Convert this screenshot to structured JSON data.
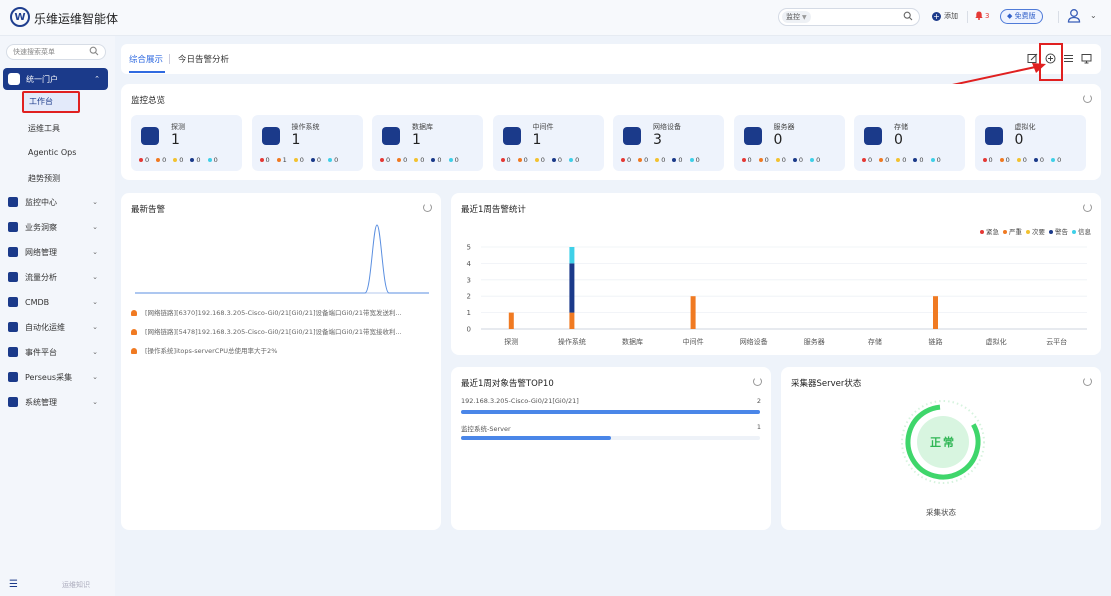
{
  "app": {
    "title": "乐维运维智能体",
    "logo_letter": "W"
  },
  "topbar": {
    "search_scope": "监控",
    "add_label": "添加",
    "alarm_count": "3",
    "edition_badge": "免费版"
  },
  "sidebar": {
    "search_placeholder": "快速搜索菜单",
    "portal_label": "统一门户",
    "sub_items": [
      "工作台",
      "运维工具",
      "Agentic Ops",
      "趋势预测"
    ],
    "active_sub": "工作台",
    "items": [
      {
        "label": "监控中心",
        "icon": "monitor-icon"
      },
      {
        "label": "业务洞察",
        "icon": "insight-icon"
      },
      {
        "label": "网络管理",
        "icon": "globe-icon"
      },
      {
        "label": "流量分析",
        "icon": "traffic-icon"
      },
      {
        "label": "CMDB",
        "icon": "cube-icon"
      },
      {
        "label": "自动化运维",
        "icon": "gear-icon"
      },
      {
        "label": "事件平台",
        "icon": "bell-icon"
      },
      {
        "label": "Perseus采集",
        "icon": "diamond-icon"
      },
      {
        "label": "系统管理",
        "icon": "settings-icon"
      }
    ],
    "footer_text": "运维知识"
  },
  "tabs": [
    {
      "label": "综合展示",
      "active": true
    },
    {
      "label": "今日告警分析",
      "active": false
    }
  ],
  "overview": {
    "title": "监控总览",
    "dot_colors": [
      "#e53935",
      "#f07a22",
      "#f2c230",
      "#1b3a8a",
      "#3fd0e8"
    ],
    "stats": [
      {
        "name": "探测",
        "value": "1",
        "icon": "globe-icon",
        "counts": [
          "0",
          "0",
          "0",
          "0",
          "0"
        ]
      },
      {
        "name": "操作系统",
        "value": "1",
        "icon": "os-icon",
        "counts": [
          "0",
          "1",
          "0",
          "0",
          "0"
        ]
      },
      {
        "name": "数据库",
        "value": "1",
        "icon": "database-icon",
        "counts": [
          "0",
          "0",
          "0",
          "0",
          "0"
        ]
      },
      {
        "name": "中间件",
        "value": "1",
        "icon": "middleware-icon",
        "counts": [
          "0",
          "0",
          "0",
          "0",
          "0"
        ]
      },
      {
        "name": "网络设备",
        "value": "3",
        "icon": "network-device-icon",
        "counts": [
          "0",
          "0",
          "0",
          "0",
          "0"
        ]
      },
      {
        "name": "服务器",
        "value": "0",
        "icon": "server-icon",
        "counts": [
          "0",
          "0",
          "0",
          "0",
          "0"
        ]
      },
      {
        "name": "存储",
        "value": "0",
        "icon": "storage-icon",
        "counts": [
          "0",
          "0",
          "0",
          "0",
          "0"
        ]
      },
      {
        "name": "虚拟化",
        "value": "0",
        "icon": "virtualization-icon",
        "counts": [
          "0",
          "0",
          "0",
          "0",
          "0"
        ]
      }
    ]
  },
  "latest_alerts": {
    "title": "最新告警",
    "items": [
      "[网络链路][6370]192.168.3.205-Cisco-Gi0/21[Gi0/21]设备端口Gi0/21带宽发送利...",
      "[网络链路][5478]192.168.3.205-Cisco-Gi0/21[Gi0/21]设备端口Gi0/21带宽接收利...",
      "[操作系统]itops-serverCPU总使用率大于2%"
    ]
  },
  "chart_data": {
    "type": "bar",
    "title": "最近1周告警统计",
    "categories": [
      "探测",
      "操作系统",
      "数据库",
      "中间件",
      "网络设备",
      "服务器",
      "存储",
      "链路",
      "虚拟化",
      "云平台"
    ],
    "series": [
      {
        "name": "紧急",
        "color": "#e53935",
        "values": [
          0,
          0,
          0,
          0,
          0,
          0,
          0,
          0,
          0,
          0
        ]
      },
      {
        "name": "严重",
        "color": "#f07a22",
        "values": [
          1,
          1,
          0,
          2,
          0,
          0,
          0,
          2,
          0,
          0
        ]
      },
      {
        "name": "次要",
        "color": "#f2c230",
        "values": [
          0,
          0,
          0,
          0,
          0,
          0,
          0,
          0,
          0,
          0
        ]
      },
      {
        "name": "警告",
        "color": "#1b3a8a",
        "values": [
          0,
          3,
          0,
          0,
          0,
          0,
          0,
          0,
          0,
          0
        ]
      },
      {
        "name": "信息",
        "color": "#3fd0e8",
        "values": [
          0,
          1,
          0,
          0,
          0,
          0,
          0,
          0,
          0,
          0
        ]
      }
    ],
    "yticks": [
      "0",
      "1",
      "2",
      "3",
      "4",
      "5"
    ],
    "ylim": [
      0,
      5
    ],
    "stacked": true,
    "legend": "top-right",
    "grid": true
  },
  "top10": {
    "title": "最近1周对象告警TOP10",
    "max": 2,
    "rows": [
      {
        "label": "192.168.3.205-Cisco-Gi0/21[Gi0/21]",
        "value": 2
      },
      {
        "label": "监控系统-Server",
        "value": 1
      }
    ]
  },
  "collector": {
    "title": "采集器Server状态",
    "status": "正常",
    "caption": "采集状态",
    "color": "#2fb654"
  }
}
